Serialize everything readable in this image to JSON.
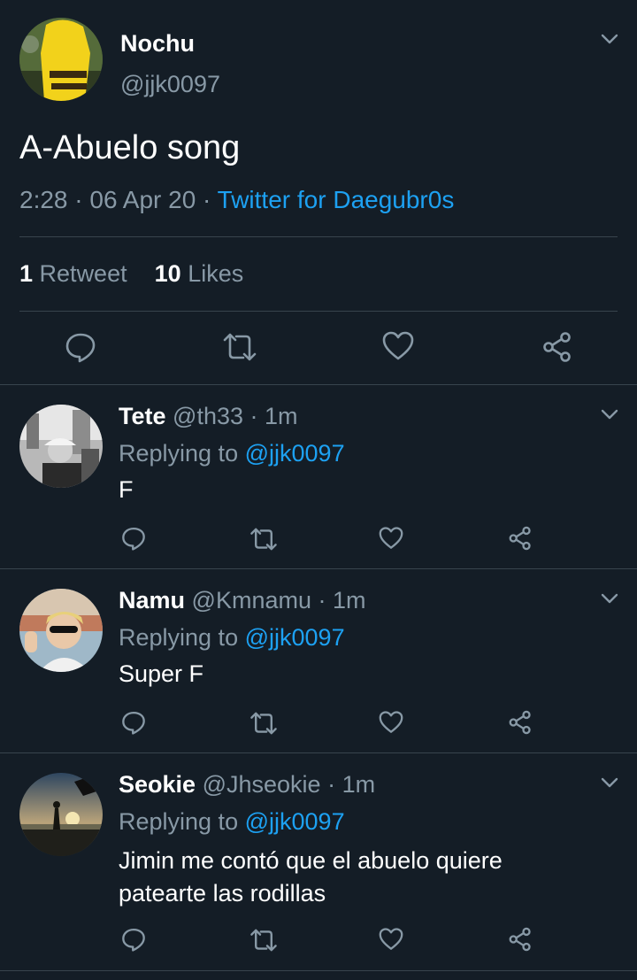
{
  "main_tweet": {
    "display_name": "Nochu",
    "handle": "@jjk0097",
    "text": "A-Abuelo song",
    "time": "2:28",
    "date": "06 Apr 20",
    "sep": "·",
    "source": "Twitter for Daegubr0s",
    "retweets_count": "1",
    "retweets_label": "Retweet",
    "likes_count": "10",
    "likes_label": "Likes"
  },
  "replies": [
    {
      "display_name": "Tete",
      "handle": "@th33",
      "time": "· 1m",
      "replying_prefix": "Replying to",
      "replying_to": "@jjk0097",
      "text": "F"
    },
    {
      "display_name": "Namu",
      "handle": "@Kmnamu",
      "time": "· 1m",
      "replying_prefix": "Replying to",
      "replying_to": "@jjk0097",
      "text": "Super F"
    },
    {
      "display_name": "Seokie",
      "handle": "@Jhseokie",
      "time": "· 1m",
      "replying_prefix": "Replying to",
      "replying_to": "@jjk0097",
      "text_line1": "Jimin me contó que el abuelo quiere",
      "text_line2": "patearte las rodillas"
    }
  ],
  "icons": {
    "reply": "speech-bubble-icon",
    "retweet": "retweet-icon",
    "like": "heart-icon",
    "share": "share-icon",
    "menu": "chevron-down-icon"
  },
  "colors": {
    "background": "#141d26",
    "accent": "#1da1f2",
    "muted": "#8899a6",
    "divider": "#38444d"
  }
}
